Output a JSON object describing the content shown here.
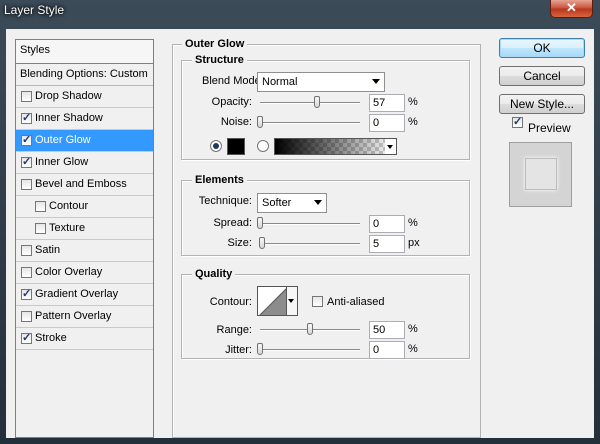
{
  "window": {
    "title": "Layer Style",
    "close_glyph": "✕"
  },
  "styles": {
    "header": "Styles",
    "blending_options": "Blending Options: Custom",
    "items": [
      {
        "label": "Drop Shadow",
        "checked": false,
        "selected": false,
        "indent": false
      },
      {
        "label": "Inner Shadow",
        "checked": true,
        "selected": false,
        "indent": false
      },
      {
        "label": "Outer Glow",
        "checked": true,
        "selected": true,
        "indent": false
      },
      {
        "label": "Inner Glow",
        "checked": true,
        "selected": false,
        "indent": false
      },
      {
        "label": "Bevel and Emboss",
        "checked": false,
        "selected": false,
        "indent": false
      },
      {
        "label": "Contour",
        "checked": false,
        "selected": false,
        "indent": true
      },
      {
        "label": "Texture",
        "checked": false,
        "selected": false,
        "indent": true
      },
      {
        "label": "Satin",
        "checked": false,
        "selected": false,
        "indent": false
      },
      {
        "label": "Color Overlay",
        "checked": false,
        "selected": false,
        "indent": false
      },
      {
        "label": "Gradient Overlay",
        "checked": true,
        "selected": false,
        "indent": false
      },
      {
        "label": "Pattern Overlay",
        "checked": false,
        "selected": false,
        "indent": false
      },
      {
        "label": "Stroke",
        "checked": true,
        "selected": false,
        "indent": false
      }
    ]
  },
  "outer_glow": {
    "title": "Outer Glow",
    "structure": {
      "title": "Structure",
      "blend_mode_label": "Blend Mode:",
      "blend_mode_value": "Normal",
      "opacity_label": "Opacity:",
      "opacity_value": "57",
      "opacity_level": 57,
      "opacity_unit": "%",
      "noise_label": "Noise:",
      "noise_value": "0",
      "noise_level": 0,
      "noise_unit": "%",
      "color_mode": "solid",
      "glow_color": "#000000"
    },
    "elements": {
      "title": "Elements",
      "technique_label": "Technique:",
      "technique_value": "Softer",
      "spread_label": "Spread:",
      "spread_value": "0",
      "spread_level": 0,
      "spread_unit": "%",
      "size_label": "Size:",
      "size_value": "5",
      "size_level": 2,
      "size_unit": "px"
    },
    "quality": {
      "title": "Quality",
      "contour_label": "Contour:",
      "anti_aliased_label": "Anti-aliased",
      "anti_aliased": false,
      "range_label": "Range:",
      "range_value": "50",
      "range_level": 50,
      "range_unit": "%",
      "jitter_label": "Jitter:",
      "jitter_value": "0",
      "jitter_level": 0,
      "jitter_unit": "%"
    }
  },
  "actions": {
    "ok": "OK",
    "cancel": "Cancel",
    "new_style": "New Style...",
    "preview_label": "Preview",
    "preview_checked": true
  },
  "colors": {
    "selection": "#3399ff",
    "dialog_bg": "#f0f0f0",
    "close_button": "#c75038"
  }
}
